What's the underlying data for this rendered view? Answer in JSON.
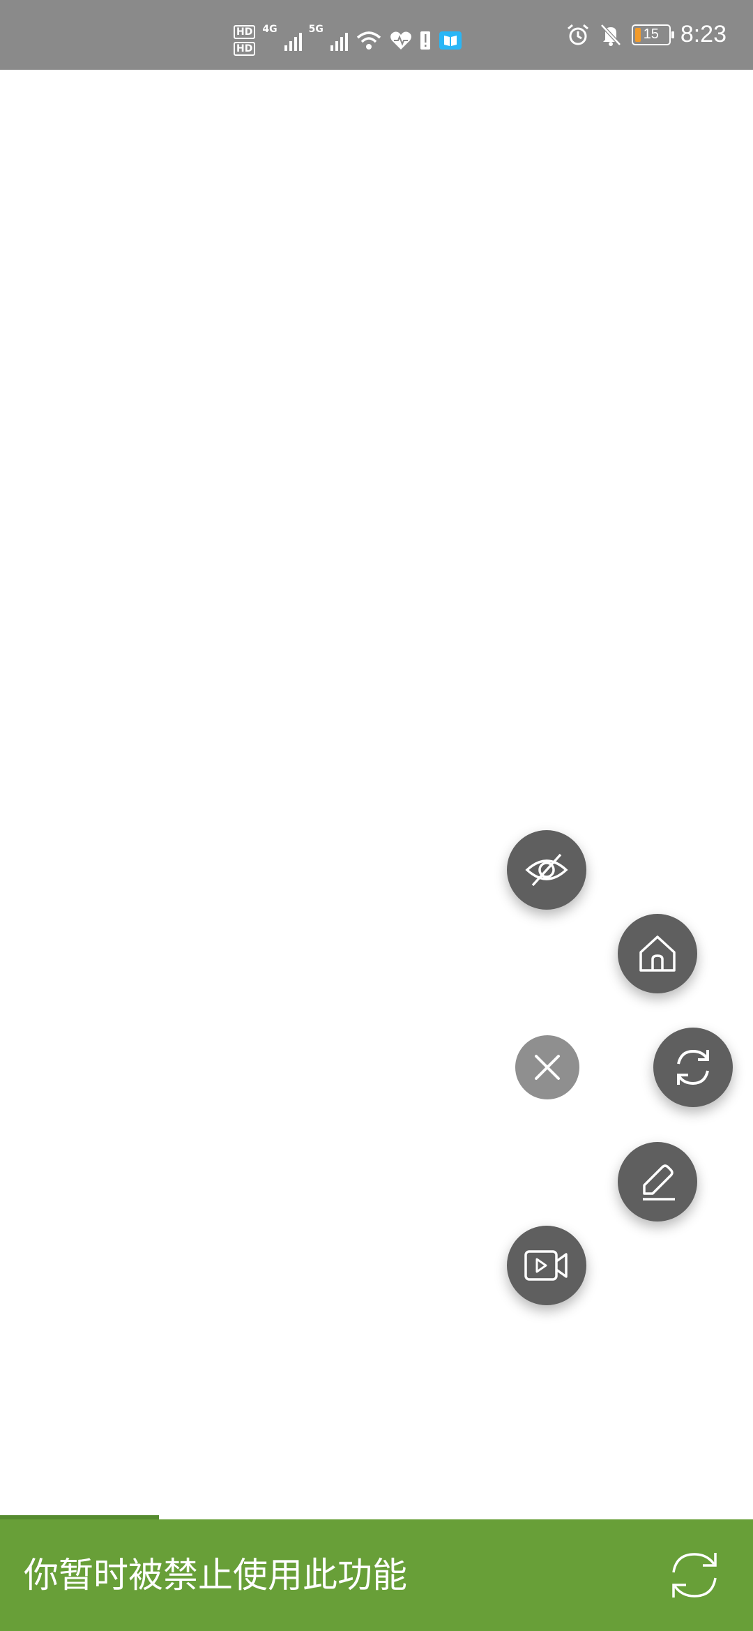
{
  "status_bar": {
    "sim1": "HD",
    "sim1_slot": "1",
    "sim2": "HD",
    "sim2_slot": "2",
    "network1": "4G",
    "network2": "5G",
    "wifi_tag": "6",
    "battery_level": "15",
    "time": "8:23",
    "icons": [
      "hd-icon",
      "signal-icon",
      "wifi-icon",
      "health-icon",
      "notice-icon",
      "book-icon",
      "alarm-icon",
      "mute-icon",
      "battery-icon"
    ]
  },
  "floating_menu": {
    "buttons": [
      {
        "name": "hide-eye-button",
        "icon": "eye-off-icon"
      },
      {
        "name": "home-button",
        "icon": "home-icon"
      },
      {
        "name": "close-button",
        "icon": "close-icon"
      },
      {
        "name": "refresh-button",
        "icon": "refresh-icon"
      },
      {
        "name": "edit-button",
        "icon": "pencil-icon"
      },
      {
        "name": "video-button",
        "icon": "video-icon"
      }
    ]
  },
  "snackbar": {
    "message": "你暂时被禁止使用此功能",
    "action_icon": "refresh-icon",
    "background": "#689f38"
  }
}
